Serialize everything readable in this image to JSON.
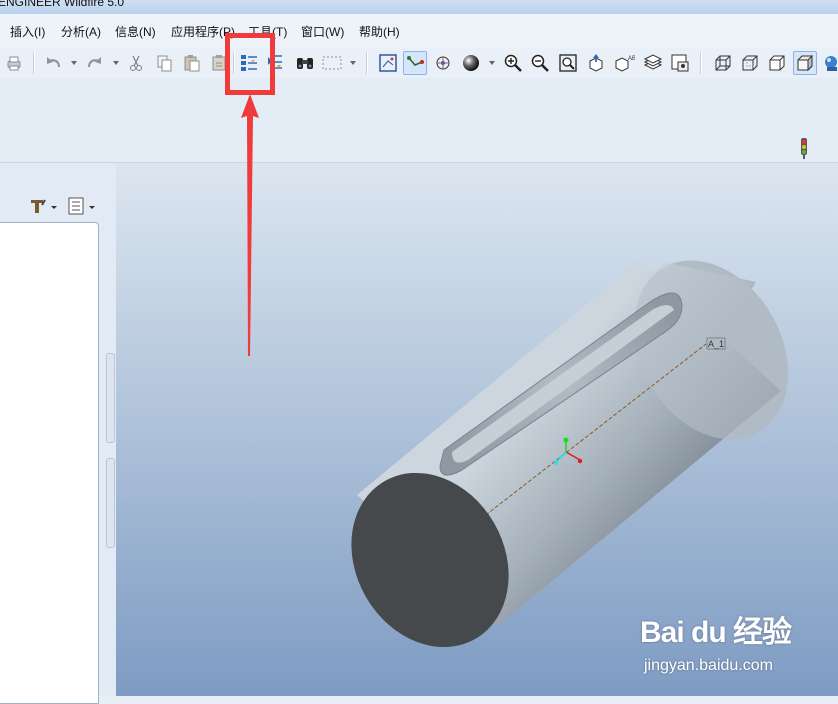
{
  "window": {
    "title": "ENGINEER Wildfire 5.0"
  },
  "menu": {
    "items": [
      {
        "label": "插入(I)"
      },
      {
        "label": "分析(A)"
      },
      {
        "label": "信息(N)"
      },
      {
        "label": "应用程序(P)"
      },
      {
        "label": "工具(T)"
      },
      {
        "label": "窗口(W)"
      },
      {
        "label": "帮助(H)"
      }
    ]
  },
  "toolbar": {
    "buttons": [
      {
        "icon": "print-icon"
      },
      {
        "icon": "undo-icon"
      },
      {
        "icon": "redo-icon"
      },
      {
        "icon": "cut-icon"
      },
      {
        "icon": "copy-icon"
      },
      {
        "icon": "paste-icon"
      },
      {
        "icon": "paste-special-icon"
      },
      {
        "icon": "regenerate-icon"
      },
      {
        "icon": "regeneration-manager-icon"
      },
      {
        "icon": "find-icon"
      },
      {
        "icon": "select-box-icon"
      },
      {
        "icon": "orient-view-icon"
      },
      {
        "icon": "datum-display-icon"
      },
      {
        "icon": "spin-center-icon"
      },
      {
        "icon": "shading-sphere-icon"
      },
      {
        "icon": "zoom-in-icon"
      },
      {
        "icon": "zoom-out-icon"
      },
      {
        "icon": "refit-icon"
      },
      {
        "icon": "reorient-icon"
      },
      {
        "icon": "saved-views-icon"
      },
      {
        "icon": "layers-icon"
      },
      {
        "icon": "view-manager-icon"
      },
      {
        "icon": "wireframe-icon"
      },
      {
        "icon": "hidden-line-icon"
      },
      {
        "icon": "no-hidden-icon"
      },
      {
        "icon": "shading-icon"
      },
      {
        "icon": "enhanced-realism-icon"
      }
    ],
    "status_light": "traffic-light-icon"
  },
  "model_tree": {
    "tool_icons": [
      "settings-icon",
      "tree-columns-icon"
    ]
  },
  "viewport": {
    "axis_label": "A_1",
    "model": "cylinder-with-slot",
    "background_top": "#dce6f0",
    "background_bottom": "#7e9bc3"
  },
  "annotation": {
    "highlight_color": "#ef3b3b",
    "target": "regenerate-icon"
  },
  "watermark": {
    "logo": "Bai du 经验",
    "url": "jingyan.baidu.com"
  }
}
